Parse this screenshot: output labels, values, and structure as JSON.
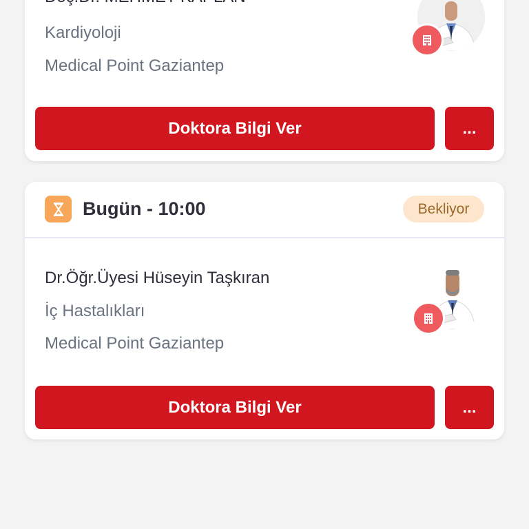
{
  "appointments": [
    {
      "doctor": {
        "name": "Doç.Dr. MEHMET KAPLAN",
        "specialty": "Kardiyoloji",
        "hospital": "Medical Point Gaziantep"
      },
      "actions": {
        "info_label": "Doktora Bilgi Ver",
        "more_label": "..."
      }
    },
    {
      "time": "Bugün - 10:00",
      "status": "Bekliyor",
      "doctor": {
        "name": "Dr.Öğr.Üyesi Hüseyin Taşkıran",
        "specialty": "İç Hastalıkları",
        "hospital": "Medical Point Gaziantep"
      },
      "actions": {
        "info_label": "Doktora Bilgi Ver",
        "more_label": "..."
      }
    }
  ],
  "icons": {
    "status_icon": "hourglass-icon",
    "hospital_icon": "building-icon"
  },
  "colors": {
    "primary": "#d2161f",
    "status_bg": "#fde6cc",
    "status_text": "#9a6a2a",
    "hourglass_bg": "#f7a65a",
    "badge_red": "#ee5a5e"
  }
}
